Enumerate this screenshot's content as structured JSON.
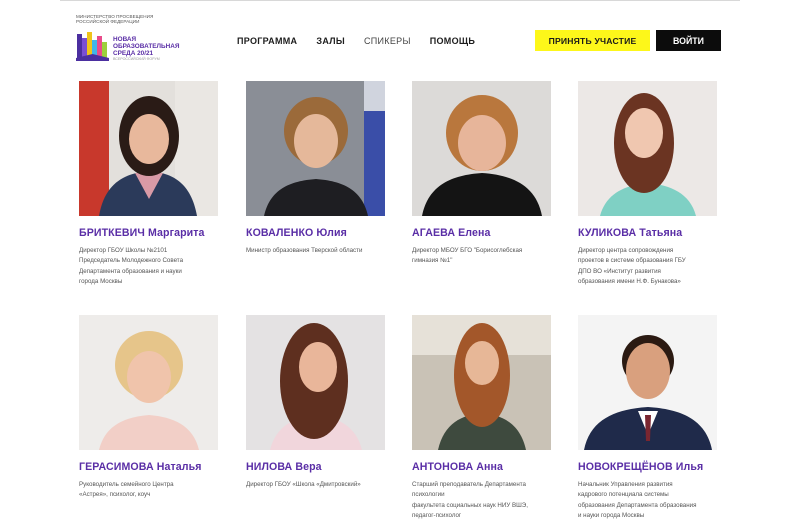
{
  "header": {
    "ministry": "МИНИСТЕРСТВО ПРОСВЕЩЕНИЯ\nРОССИЙСКОЙ ФЕДЕРАЦИИ",
    "logo_text": "НОВАЯ\nОБРАЗОВАТЕЛЬНАЯ\nСРЕДА 20/21",
    "logo_sub": "ВСЕРОССИЙСКИЙ ФОРУМ",
    "nav": [
      {
        "label": "ПРОГРАММА"
      },
      {
        "label": "ЗАЛЫ"
      },
      {
        "label": "СПИКЕРЫ"
      },
      {
        "label": "ПОМОЩЬ"
      }
    ],
    "register_label": "ПРИНЯТЬ УЧАСТИЕ",
    "login_label": "ВОЙТИ"
  },
  "colors": {
    "accent": "#5a2ea6",
    "register_bg": "#fdf71a",
    "login_bg": "#0c0c0c"
  },
  "speakers": [
    {
      "name": "БРИТКЕВИЧ Маргарита",
      "role": "Директор ГБОУ Школы №2101\nПредседатель Молодежного Совета\nДепартамента образования и науки\nгорода Москвы"
    },
    {
      "name": "КОВАЛЕНКО Юлия",
      "role": "Министр образования Тверской области"
    },
    {
      "name": "АГАЕВА Елена",
      "role": "Директор МБОУ БГО \"Борисоглебская\nгимназия №1\""
    },
    {
      "name": "КУЛИКОВА Татьяна",
      "role": "Директор центра сопровождения\nпроектов в системе образования ГБУ\nДПО ВО «Институт развития\nобразования имени Н.Ф. Бунакова»"
    },
    {
      "name": "ГЕРАСИМОВА Наталья",
      "role": "Руководитель семейного Центра\n«Астрея», психолог, коуч"
    },
    {
      "name": "НИЛОВА Вера",
      "role": "Директор ГБОУ «Школа «Дмитровский»"
    },
    {
      "name": "АНТОНОВА Анна",
      "role": "Старший преподаватель Департамента\nпсихологии\nфакультета социальных наук НИУ ВШЭ,\nпедагог-психолог"
    },
    {
      "name": "НОВОКРЕЩЁНОВ Илья",
      "role": "Начальник Управления развития\nкадрового потенциала системы\nобразования Департамента образования\nи науки города Москвы"
    }
  ]
}
